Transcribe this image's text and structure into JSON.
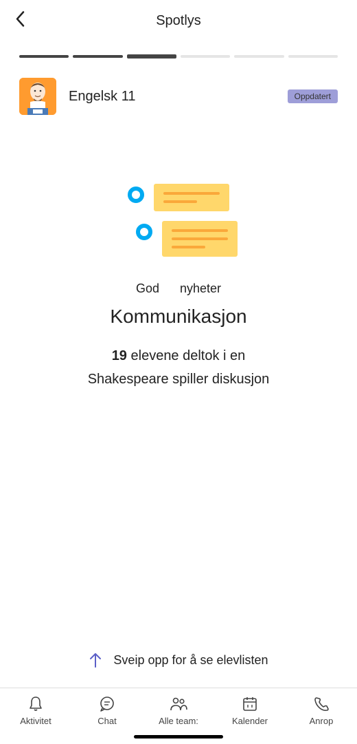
{
  "header": {
    "title": "Spotlys"
  },
  "progress": {
    "segments": [
      "done",
      "done",
      "active",
      "pending",
      "pending",
      "pending"
    ]
  },
  "class": {
    "name": "Engelsk 11",
    "badge": "Oppdatert"
  },
  "caption": {
    "word1": "God",
    "word2": "nyheter"
  },
  "main": {
    "title": "Kommunikasjon",
    "count": "19",
    "line1_rest": "elevene deltok i en",
    "line2": "Shakespeare spiller diskusjon"
  },
  "swipe": {
    "text": "Sveip opp for å se elevlisten"
  },
  "nav": {
    "activity": "Aktivitet",
    "chat": "Chat",
    "teams": "Alle team:",
    "calendar": "Kalender",
    "calls": "Anrop"
  }
}
